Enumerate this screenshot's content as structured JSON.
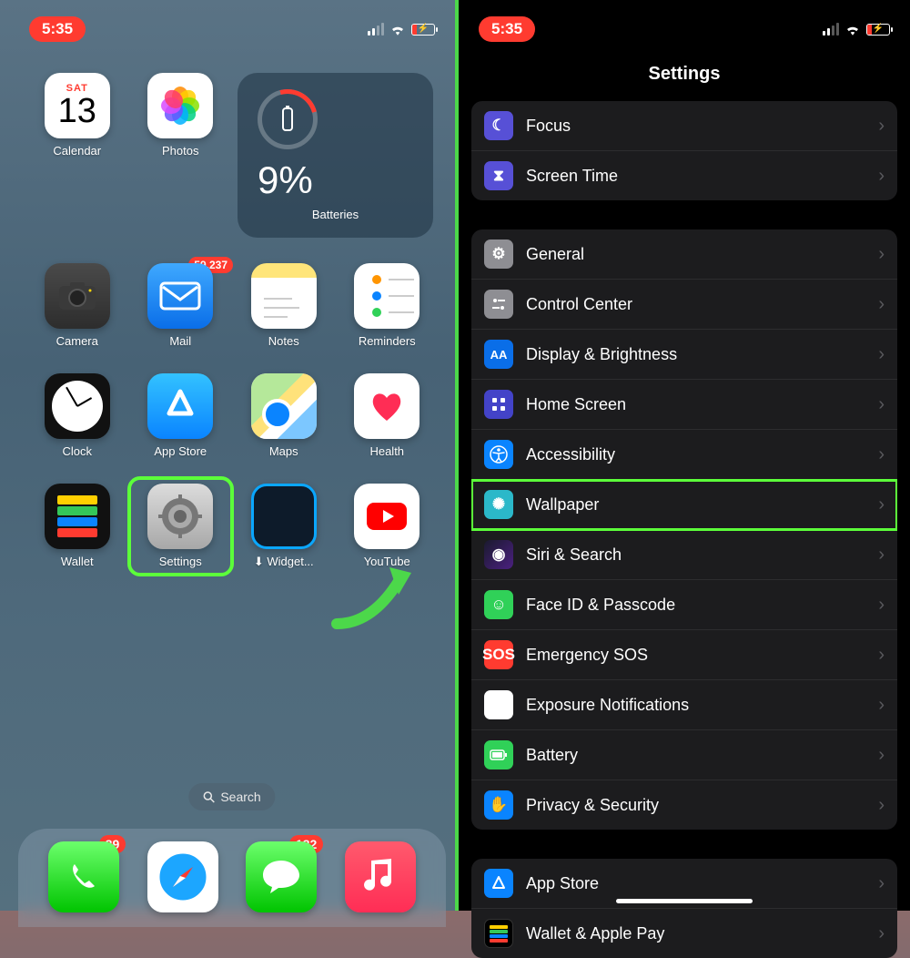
{
  "status": {
    "time": "5:35"
  },
  "home": {
    "apps": {
      "calendar": {
        "label": "Calendar",
        "day": "SAT",
        "date": "13"
      },
      "photos": {
        "label": "Photos"
      },
      "camera": {
        "label": "Camera"
      },
      "mail": {
        "label": "Mail",
        "badge": "59,237"
      },
      "notes": {
        "label": "Notes"
      },
      "reminders": {
        "label": "Reminders"
      },
      "clock": {
        "label": "Clock"
      },
      "appstore": {
        "label": "App Store"
      },
      "maps": {
        "label": "Maps"
      },
      "health": {
        "label": "Health"
      },
      "wallet": {
        "label": "Wallet"
      },
      "settings": {
        "label": "Settings"
      },
      "widget": {
        "label": "Widget..."
      },
      "youtube": {
        "label": "YouTube"
      }
    },
    "battery_widget": {
      "percent": "9%",
      "label": "Batteries"
    },
    "search": "Search",
    "dock": {
      "phone": {
        "badge": "89"
      },
      "messages": {
        "badge": "182"
      }
    }
  },
  "settings": {
    "title": "Settings",
    "group1": {
      "focus": "Focus",
      "screentime": "Screen Time"
    },
    "group2": {
      "general": "General",
      "control": "Control Center",
      "display": "Display & Brightness",
      "home": "Home Screen",
      "access": "Accessibility",
      "wallpaper": "Wallpaper",
      "siri": "Siri & Search",
      "face": "Face ID & Passcode",
      "sos": "Emergency SOS",
      "exposure": "Exposure Notifications",
      "battery": "Battery",
      "privacy": "Privacy & Security"
    },
    "group3": {
      "appstore": "App Store",
      "walletpay": "Wallet & Apple Pay"
    }
  }
}
